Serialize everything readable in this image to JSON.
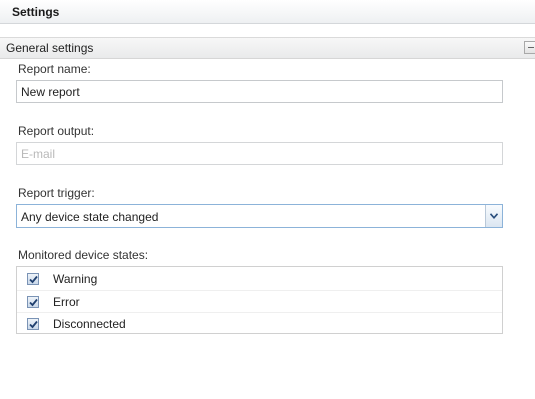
{
  "window": {
    "title": "Settings"
  },
  "section": {
    "title": "General settings"
  },
  "report_name": {
    "label": "Report name:",
    "value": "New report"
  },
  "report_output": {
    "label": "Report output:",
    "placeholder": "E-mail"
  },
  "report_trigger": {
    "label": "Report trigger:",
    "selected": "Any device state changed"
  },
  "monitored_states": {
    "label": "Monitored device states:",
    "items": [
      {
        "label": "Warning",
        "checked": true
      },
      {
        "label": "Error",
        "checked": true
      },
      {
        "label": "Disconnected",
        "checked": true
      }
    ]
  },
  "colors": {
    "accent_border": "#8cb3d9",
    "check_color": "#1f3f6e"
  },
  "icons": {
    "collapse": "minus-icon",
    "dropdown": "chevron-down-icon",
    "check": "checkmark-icon"
  }
}
